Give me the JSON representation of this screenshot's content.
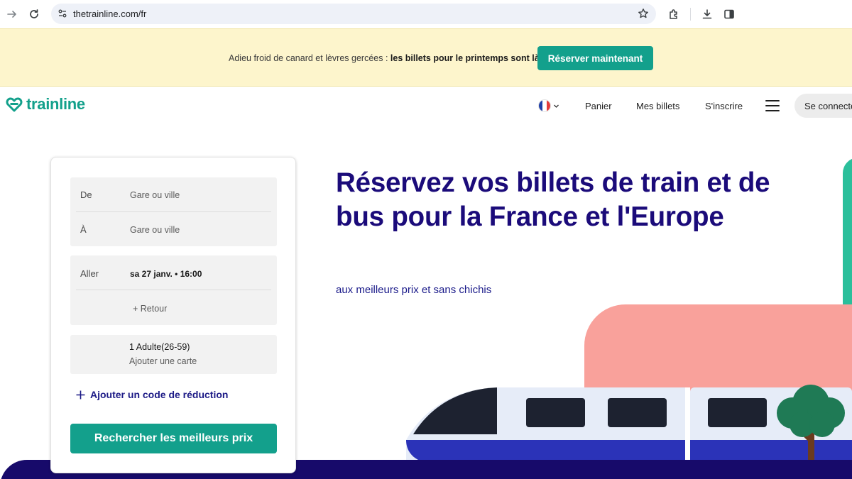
{
  "browser": {
    "url": "thetrainline.com/fr",
    "icons": [
      "forward-icon",
      "reload-icon",
      "site-info-icon",
      "bookmark-star-icon",
      "extensions-icon",
      "download-icon",
      "side-panel-icon"
    ]
  },
  "promo": {
    "text": "Adieu froid de canard et lèvres gercées : ",
    "text_bold": "les billets pour le printemps sont là !",
    "button": "Réserver maintenant",
    "background": "#fdf5cc",
    "button_color": "#13a08c"
  },
  "header": {
    "logo": "trainline",
    "language": "FR flag",
    "nav": [
      "Panier",
      "Mes billets",
      "S'inscrire"
    ],
    "login": "Se connecter",
    "brand_color": "#12a08b"
  },
  "search": {
    "from_label": "De",
    "from_placeholder": "Gare ou ville",
    "to_label": "À",
    "to_placeholder": "Gare ou ville",
    "outbound_label": "Aller",
    "outbound_value": "sa 27 janv. • 16:00",
    "return_link": "+ Retour",
    "passengers": "1 Adulte(26-59)",
    "add_card": "Ajouter une carte",
    "discount": "Ajouter un code de réduction",
    "submit": "Rechercher les meilleurs prix"
  },
  "hero": {
    "title": "Réservez vos billets de train et de bus pour la France et l'Europe",
    "subtitle": "aux meilleurs prix et sans chichis",
    "title_color": "#1b0b7a"
  }
}
